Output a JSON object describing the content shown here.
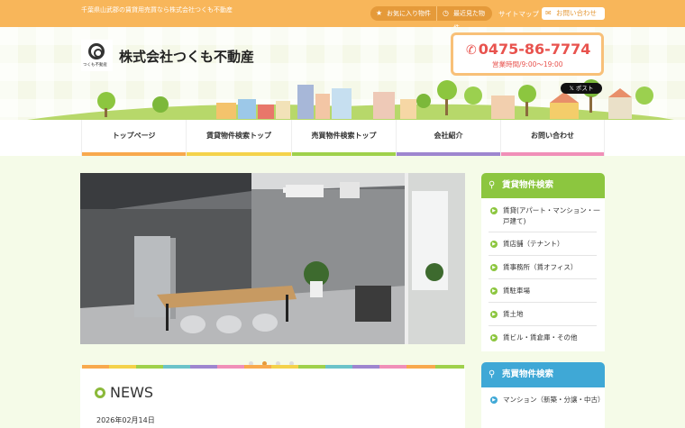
{
  "topbar": {
    "tagline": "千葉県山武郡の賃貸用売買なら株式会社つくも不動産",
    "favorites": "お気に入り物件",
    "recent": "最近見た物件",
    "sitemap": "サイトマップ",
    "contact": "お問い合わせ",
    "icons": [
      "star-icon",
      "clock-icon",
      "mail-icon"
    ]
  },
  "header": {
    "logo_text": "つくも不動産",
    "company": "株式会社つくも不動産",
    "phone": "0475-86-7774",
    "hours": "営業時間/9:00〜19:00",
    "x_post": "ポスト"
  },
  "nav": {
    "items": [
      {
        "label": "トップページ",
        "color": "#f8a94d"
      },
      {
        "label": "賃貸物件検索トップ",
        "color": "#f4d24a"
      },
      {
        "label": "売買物件検索トップ",
        "color": "#9fd14b"
      },
      {
        "label": "会社紹介",
        "color": "#9e86cf"
      },
      {
        "label": "お問い合わせ",
        "color": "#f08fb8"
      }
    ]
  },
  "news": {
    "title": "NEWS",
    "date": "2026年02月14日"
  },
  "sidebar": {
    "rent": {
      "title": "賃貸物件検索",
      "items": [
        "賃貸(アパート・マンション・一戸建て)",
        "賃店舗（テナント）",
        "賃事務所（賃オフィス）",
        "賃駐車場",
        "賃土地",
        "賃ビル・賃倉庫・その他"
      ]
    },
    "sale": {
      "title": "売買物件検索",
      "items": [
        "マンション（新築・分譲・中古）"
      ]
    }
  },
  "colors": {
    "topbar": "#f8b65a",
    "phone": "#e8534e",
    "rent_green": "#8cc63f",
    "sale_blue": "#3fa8d6"
  }
}
